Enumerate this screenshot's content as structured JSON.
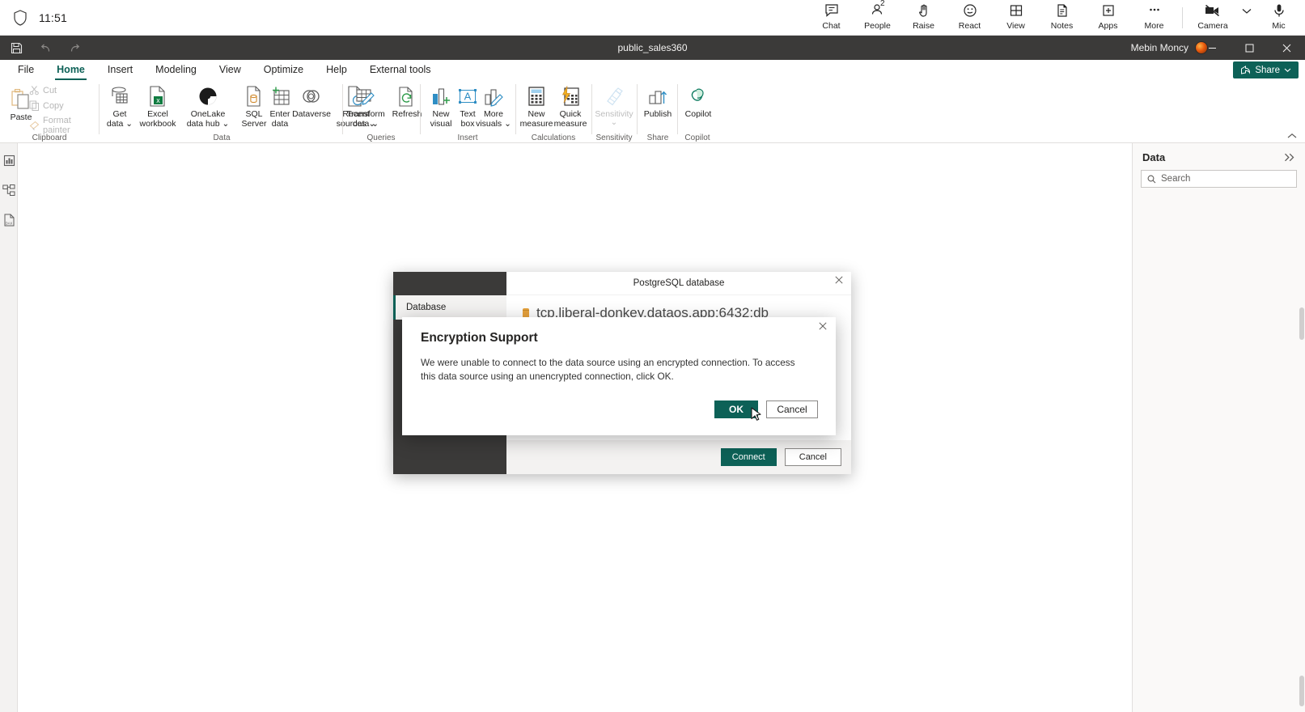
{
  "teams_bar": {
    "shield_icon": "shield-icon",
    "clock": "11:51",
    "items": [
      {
        "label": "Chat",
        "icon": "chat-icon",
        "badge": ""
      },
      {
        "label": "People",
        "icon": "people-icon",
        "badge": "2"
      },
      {
        "label": "Raise",
        "icon": "raise-hand-icon",
        "badge": ""
      },
      {
        "label": "React",
        "icon": "react-smiley-icon",
        "badge": ""
      },
      {
        "label": "View",
        "icon": "view-grid-icon",
        "badge": ""
      },
      {
        "label": "Notes",
        "icon": "notes-icon",
        "badge": ""
      },
      {
        "label": "Apps",
        "icon": "apps-plus-icon",
        "badge": ""
      },
      {
        "label": "More",
        "icon": "more-ellipsis-icon",
        "badge": ""
      }
    ],
    "camera": {
      "label": "Camera",
      "icon": "camera-off-icon"
    },
    "mic": {
      "label": "Mic",
      "icon": "microphone-icon"
    }
  },
  "titlebar": {
    "document_name": "public_sales360",
    "user_name": "Mebin Moncy",
    "save_icon": "save-icon",
    "undo_icon": "undo-icon",
    "redo_icon": "redo-icon",
    "minimize": "minimize-icon",
    "maximize": "maximize-icon",
    "close": "close-icon"
  },
  "ribbon": {
    "tabs": [
      {
        "label": "File",
        "active": false
      },
      {
        "label": "Home",
        "active": true
      },
      {
        "label": "Insert",
        "active": false
      },
      {
        "label": "Modeling",
        "active": false
      },
      {
        "label": "View",
        "active": false
      },
      {
        "label": "Optimize",
        "active": false
      },
      {
        "label": "Help",
        "active": false
      },
      {
        "label": "External tools",
        "active": false
      }
    ],
    "share_label": "Share",
    "collapse_icon": "chevron-up-icon",
    "groups": [
      {
        "name": "Clipboard"
      },
      {
        "name": "Data"
      },
      {
        "name": "Queries"
      },
      {
        "name": "Insert"
      },
      {
        "name": "Calculations"
      },
      {
        "name": "Sensitivity"
      },
      {
        "name": "Share"
      },
      {
        "name": "Copilot"
      }
    ],
    "clipboard": {
      "paste": "Paste",
      "cut": "Cut",
      "copy": "Copy",
      "format_painter": "Format painter"
    },
    "data": {
      "get_data_l1": "Get",
      "get_data_l2": "data",
      "excel_l1": "Excel",
      "excel_l2": "workbook",
      "onelake_l1": "OneLake",
      "onelake_l2": "data hub",
      "sql_l1": "SQL",
      "sql_l2": "Server",
      "enter_l1": "Enter",
      "enter_l2": "data",
      "dataverse": "Dataverse",
      "recent_l1": "Recent",
      "recent_l2": "sources"
    },
    "queries": {
      "transform_l1": "Transform",
      "transform_l2": "data",
      "refresh": "Refresh"
    },
    "insert": {
      "new_visual_l1": "New",
      "new_visual_l2": "visual",
      "text_box_l1": "Text",
      "text_box_l2": "box",
      "more_visuals_l1": "More",
      "more_visuals_l2": "visuals"
    },
    "calculations": {
      "new_measure_l1": "New",
      "new_measure_l2": "measure",
      "quick_measure_l1": "Quick",
      "quick_measure_l2": "measure"
    },
    "sensitivity": {
      "label": "Sensitivity"
    },
    "share": {
      "publish": "Publish"
    },
    "copilot": {
      "label": "Copilot"
    }
  },
  "left_rail": {
    "items": [
      {
        "name": "report-view",
        "icon": "bar-chart-icon"
      },
      {
        "name": "model-view",
        "icon": "model-relationships-icon"
      },
      {
        "name": "dax-query-view",
        "icon": "dax-query-icon"
      }
    ]
  },
  "data_pane": {
    "title": "Data",
    "expand_icon": "double-chevron-right-icon",
    "search_icon": "search-icon",
    "search_placeholder": "Search",
    "search_value": ""
  },
  "postgres_dialog": {
    "title": "PostgreSQL database",
    "nav_item": "Database",
    "connection_string": "tcp.liberal-donkey.dataos.app:6432;db",
    "database_icon": "database-cylinder-icon",
    "close_icon": "close-icon",
    "connect_button": "Connect",
    "cancel_button": "Cancel"
  },
  "encryption_dialog": {
    "title": "Encryption Support",
    "body": "We were unable to connect to the data source using an encrypted connection. To access this data source using an unencrypted connection, click OK.",
    "ok_button": "OK",
    "cancel_button": "Cancel",
    "close_icon": "close-icon"
  },
  "colors": {
    "accent_teal": "#0d6157",
    "titlebar_dark": "#3b3a39",
    "panel_gray": "#faf9f8",
    "border_gray": "#e1dfdd"
  }
}
